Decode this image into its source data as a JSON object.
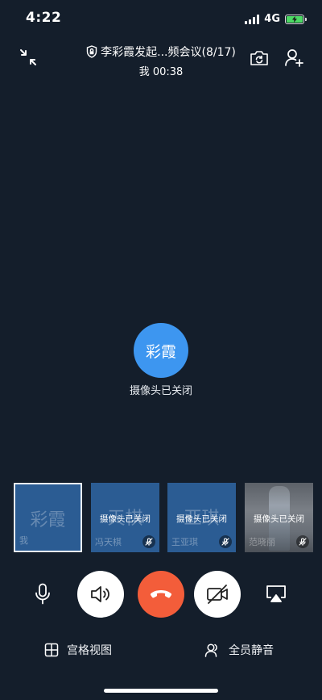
{
  "status_bar": {
    "time": "4:22",
    "network": "4G"
  },
  "header": {
    "title": "李彩霞发起...频会议(8/17)",
    "subtitle": "我 00:38"
  },
  "main_speaker": {
    "avatar_text": "彩霞",
    "status": "摄像头已关闭",
    "avatar_color": "#3d96f0"
  },
  "participants": [
    {
      "bg_name": "彩霞",
      "name": "我",
      "overlay": "",
      "muted": false,
      "selected": true
    },
    {
      "bg_name": "天棋",
      "name": "冯天棋",
      "overlay": "摄像头已关闭",
      "muted": true,
      "selected": false
    },
    {
      "bg_name": "亚琪",
      "name": "王亚琪",
      "overlay": "摄像头已关闭",
      "muted": true,
      "selected": false
    },
    {
      "bg_name": "",
      "name": "范晓丽",
      "overlay": "摄像头已关闭",
      "muted": true,
      "selected": false
    }
  ],
  "controls": {
    "mic_icon": "microphone-icon",
    "speaker_icon": "speaker-icon",
    "hangup_icon": "hangup-icon",
    "camera_icon": "camera-off-icon",
    "airplay_icon": "screen-share-icon",
    "hangup_color": "#f35d3a"
  },
  "bottom_bar": {
    "grid_view_label": "宫格视图",
    "mute_all_label": "全员静音"
  }
}
